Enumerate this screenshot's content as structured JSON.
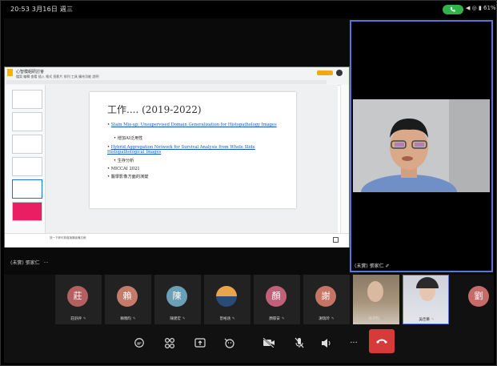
{
  "status_bar": {
    "time": "20:53  3月16日 週三",
    "right_text": "◀ ◎ ▮ 61%"
  },
  "share": {
    "app": {
      "doc_title": "心智模組研討會",
      "menu": "檔案 編輯 查看 插入 格式 投影片 排列 工具 擴充功能 說明"
    },
    "slide": {
      "title": "工作.... (2019-2022)",
      "bullets": [
        {
          "text": "Stain Mix-up: Unsupervised Domain Generalization for Histopathology Images",
          "link": true
        },
        {
          "text": "增加AI泛用性",
          "sub": true
        },
        {
          "text": "Hybrid Aggregation Network for Survival Analysis from Whole Slide Histopathological Images",
          "link": true
        },
        {
          "text": "生存分析",
          "sub": true
        },
        {
          "text": "MICCAI 2021"
        },
        {
          "text": "醫學影像方面的演變"
        }
      ]
    },
    "notes_text": "按一下即可新增演講者備忘稿",
    "presenter_label": "(未實) 張家仁",
    "more_label": "···"
  },
  "video_tile": {
    "label": "(未實) 張家仁 ✐"
  },
  "participants": [
    {
      "initial": "莊",
      "name": "莊舒評",
      "color": "#b36060"
    },
    {
      "initial": "賴",
      "name": "賴曉昀",
      "color": "#c47b6a"
    },
    {
      "initial": "陳",
      "name": "陳建宏",
      "color": "#6a9fb5"
    },
    {
      "initial": "",
      "name": "曾裕涵",
      "color": "#cc8a3c"
    },
    {
      "initial": "顏",
      "name": "顏郁安",
      "color": "#c2607a"
    },
    {
      "initial": "謝",
      "name": "謝瑞玲",
      "color": "#c57466"
    }
  ],
  "video_participants": [
    {
      "name": "徐子昀"
    },
    {
      "name": "吳佳蓁"
    }
  ],
  "extra_participant": {
    "initial": "劉",
    "color": "#c66a6a"
  },
  "mic_mark": "✎",
  "controls": {
    "chat": "chat-icon",
    "participants": "people-icon",
    "share": "share-screen-icon",
    "reactions": "raise-hand-icon",
    "camera": "camera-off-icon",
    "mic": "mic-off-icon",
    "speaker": "speaker-icon",
    "more": "···",
    "hangup": "hang-up-icon"
  }
}
